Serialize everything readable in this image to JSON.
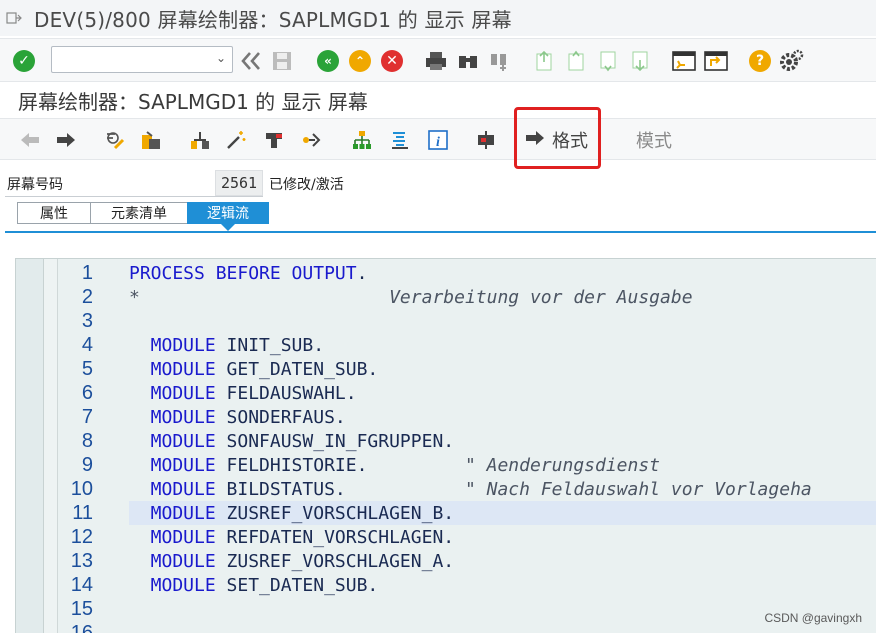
{
  "window": {
    "title": "DEV(5)/800 屏幕绘制器：SAPLMGD1 的 显示 屏幕"
  },
  "toolbar1": {
    "command_field_value": "",
    "icons": [
      "check-icon",
      "back-double-icon",
      "save-icon",
      "back-icon",
      "exit-icon",
      "cancel-icon",
      "print-icon",
      "find-icon",
      "find-next-icon",
      "first-page-icon",
      "prev-page-icon",
      "next-page-icon",
      "last-page-icon",
      "new-session-icon",
      "shortcut-icon",
      "help-icon",
      "settings-icon"
    ]
  },
  "screen_title": "屏幕绘制器：SAPLMGD1 的 显示 屏幕",
  "toolbar2": {
    "format_label": "格式",
    "pattern_label": "模式"
  },
  "screen_number": {
    "label": "屏幕号码",
    "value": "2561",
    "status": "已修改/激活"
  },
  "tabs": [
    {
      "label": "属性"
    },
    {
      "label": "元素清单"
    },
    {
      "label": "逻辑流"
    }
  ],
  "editor": {
    "lines": [
      {
        "no": "1",
        "kw": "PROCESS BEFORE OUTPUT",
        "rest": ".",
        "comment": ""
      },
      {
        "no": "2",
        "kw": "",
        "rest": "*",
        "comment": "                       Verarbeitung vor der Ausgabe"
      },
      {
        "no": "3",
        "kw": "",
        "rest": "",
        "comment": ""
      },
      {
        "no": "4",
        "kw": "  MODULE",
        "rest": " INIT_SUB.",
        "comment": ""
      },
      {
        "no": "5",
        "kw": "  MODULE",
        "rest": " GET_DATEN_SUB.",
        "comment": ""
      },
      {
        "no": "6",
        "kw": "  MODULE",
        "rest": " FELDAUSWAHL.",
        "comment": ""
      },
      {
        "no": "7",
        "kw": "  MODULE",
        "rest": " SONDERFAUS.",
        "comment": ""
      },
      {
        "no": "8",
        "kw": "  MODULE",
        "rest": " SONFAUSW_IN_FGRUPPEN.",
        "comment": ""
      },
      {
        "no": "9",
        "kw": "  MODULE",
        "rest": " FELDHISTORIE.",
        "comment": "         \" Aenderungsdienst"
      },
      {
        "no": "10",
        "kw": "  MODULE",
        "rest": " BILDSTATUS.",
        "comment": "           \" Nach Feldauswahl vor Vorlageha"
      },
      {
        "no": "11",
        "kw": "  MODULE",
        "rest": " ZUSREF_VORSCHLAGEN_B.",
        "comment": ""
      },
      {
        "no": "12",
        "kw": "  MODULE",
        "rest": " REFDATEN_VORSCHLAGEN.",
        "comment": ""
      },
      {
        "no": "13",
        "kw": "  MODULE",
        "rest": " ZUSREF_VORSCHLAGEN_A.",
        "comment": ""
      },
      {
        "no": "14",
        "kw": "  MODULE",
        "rest": " SET_DATEN_SUB.",
        "comment": ""
      },
      {
        "no": "15",
        "kw": "",
        "rest": "",
        "comment": ""
      },
      {
        "no": "16",
        "kw": "",
        "rest": "",
        "comment": ""
      }
    ],
    "highlighted_line": "11"
  },
  "watermark": "CSDN @gavingxh"
}
